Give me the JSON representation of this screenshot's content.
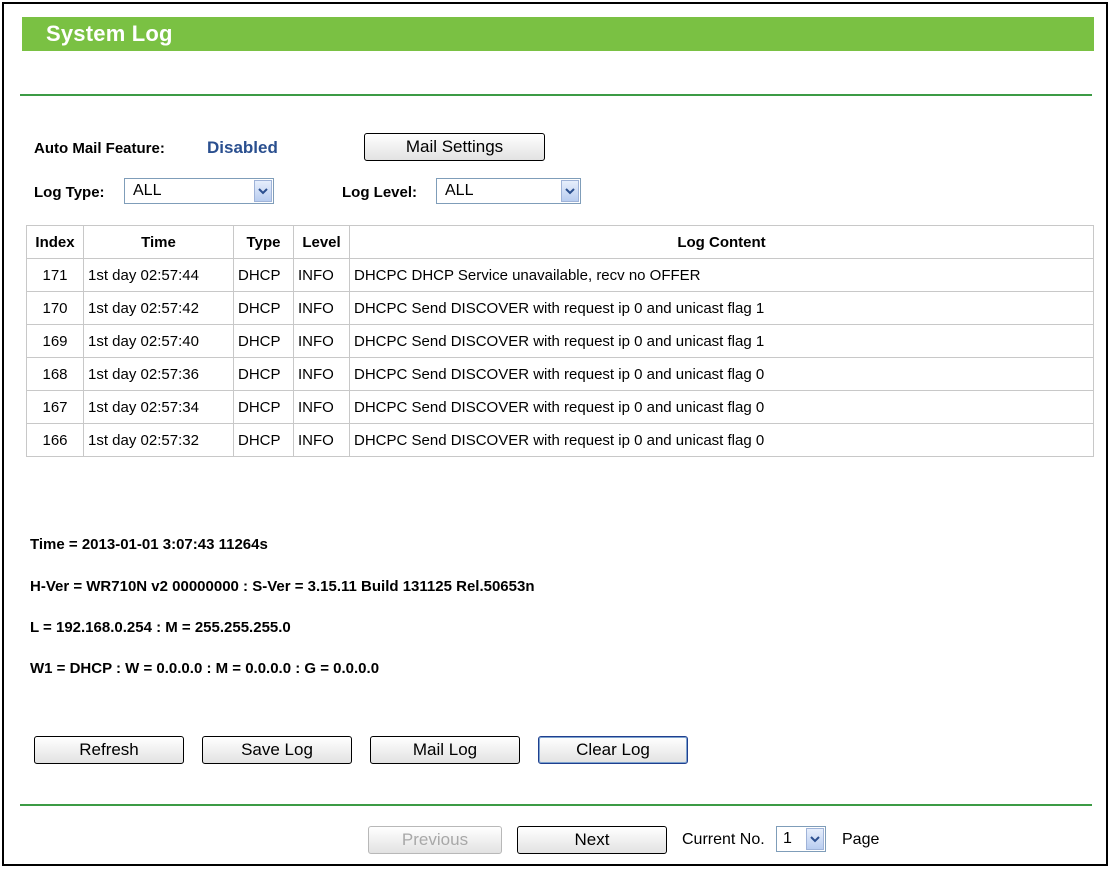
{
  "header": {
    "title": "System Log"
  },
  "mail": {
    "label": "Auto Mail Feature:",
    "status": "Disabled",
    "settings_button": "Mail Settings"
  },
  "filters": {
    "log_type_label": "Log Type:",
    "log_type_value": "ALL",
    "log_level_label": "Log Level:",
    "log_level_value": "ALL"
  },
  "table": {
    "headers": [
      "Index",
      "Time",
      "Type",
      "Level",
      "Log Content"
    ],
    "rows": [
      [
        "171",
        "1st day 02:57:44",
        "DHCP",
        "INFO",
        "DHCPC DHCP Service unavailable, recv no OFFER"
      ],
      [
        "170",
        "1st day 02:57:42",
        "DHCP",
        "INFO",
        "DHCPC Send DISCOVER with request ip 0 and unicast flag 1"
      ],
      [
        "169",
        "1st day 02:57:40",
        "DHCP",
        "INFO",
        "DHCPC Send DISCOVER with request ip 0 and unicast flag 1"
      ],
      [
        "168",
        "1st day 02:57:36",
        "DHCP",
        "INFO",
        "DHCPC Send DISCOVER with request ip 0 and unicast flag 0"
      ],
      [
        "167",
        "1st day 02:57:34",
        "DHCP",
        "INFO",
        "DHCPC Send DISCOVER with request ip 0 and unicast flag 0"
      ],
      [
        "166",
        "1st day 02:57:32",
        "DHCP",
        "INFO",
        "DHCPC Send DISCOVER with request ip 0 and unicast flag 0"
      ]
    ]
  },
  "info": {
    "time": "Time = 2013-01-01 3:07:43 11264s",
    "version": "H-Ver = WR710N v2 00000000 : S-Ver = 3.15.11 Build 131125 Rel.50653n",
    "lan": "L = 192.168.0.254 : M = 255.255.255.0",
    "wan": "W1 = DHCP : W = 0.0.0.0 : M = 0.0.0.0 : G = 0.0.0.0"
  },
  "actions": {
    "refresh": "Refresh",
    "save_log": "Save Log",
    "mail_log": "Mail Log",
    "clear_log": "Clear Log"
  },
  "pager": {
    "previous": "Previous",
    "next": "Next",
    "current_label": "Current No.",
    "current_value": "1",
    "page_label": "Page"
  }
}
